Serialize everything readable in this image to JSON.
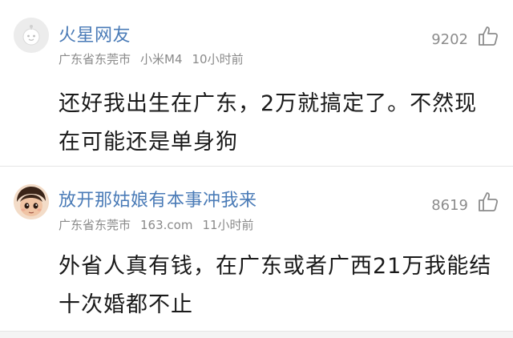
{
  "comments": [
    {
      "username": "火星网友",
      "location": "广东省东莞市",
      "device": "小米M4",
      "time": "10小时前",
      "likes": "9202",
      "avatar_icon": "default-avatar-icon",
      "content": "还好我出生在广东，2万就搞定了。不然现在可能还是单身狗"
    },
    {
      "username": "放开那姑娘有本事冲我来",
      "location": "广东省东莞市",
      "device": "163.com",
      "time": "11小时前",
      "likes": "8619",
      "avatar_icon": "cartoon-girl-avatar",
      "content": "外省人真有钱，在广东或者广西21万我能结十次婚都不止"
    }
  ],
  "colors": {
    "username": "#4a7bb7",
    "meta": "#8a8a8a",
    "divider": "#e6e6e6"
  }
}
